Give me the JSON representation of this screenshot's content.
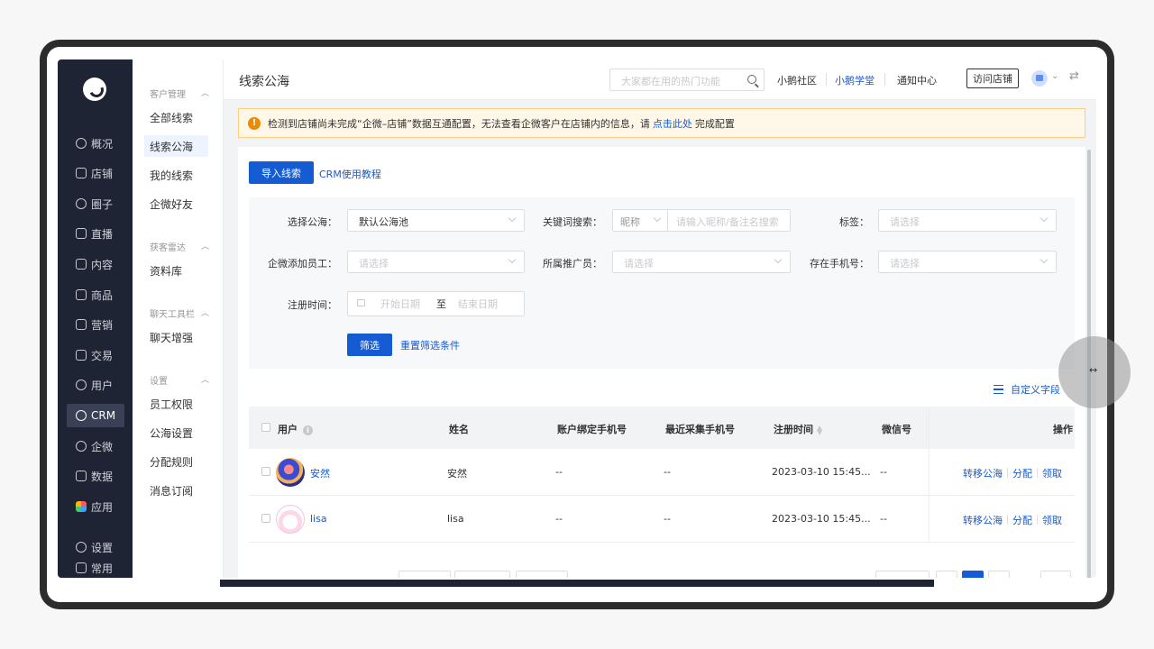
{
  "nav": {
    "items": [
      {
        "label": "概况",
        "icon": "dashboard-icon"
      },
      {
        "label": "店铺",
        "icon": "store-icon"
      },
      {
        "label": "圈子",
        "icon": "circle-icon"
      },
      {
        "label": "直播",
        "icon": "live-icon"
      },
      {
        "label": "内容",
        "icon": "content-icon"
      },
      {
        "label": "商品",
        "icon": "goods-icon"
      },
      {
        "label": "营销",
        "icon": "marketing-icon"
      },
      {
        "label": "交易",
        "icon": "trade-icon"
      },
      {
        "label": "用户",
        "icon": "user-icon"
      },
      {
        "label": "CRM",
        "icon": "crm-icon",
        "active": true
      },
      {
        "label": "企微",
        "icon": "wecom-icon"
      },
      {
        "label": "数据",
        "icon": "data-icon"
      },
      {
        "label": "应用",
        "icon": "app-icon"
      }
    ],
    "bottom": [
      {
        "label": "设置",
        "icon": "gear-icon"
      },
      {
        "label": "常用",
        "icon": "list-icon"
      }
    ]
  },
  "subnav": {
    "groups": [
      {
        "title": "客户管理",
        "items": [
          "全部线索",
          "线索公海",
          "我的线索",
          "企微好友"
        ]
      },
      {
        "title": "获客雷达",
        "items": [
          "资料库"
        ]
      },
      {
        "title": "聊天工具栏",
        "items": [
          "聊天增强"
        ]
      },
      {
        "title": "设置",
        "items": [
          "员工权限",
          "公海设置",
          "分配规则",
          "消息订阅"
        ]
      }
    ],
    "active": "线索公海"
  },
  "header": {
    "title": "线索公海",
    "search_placeholder": "大家都在用的热门功能",
    "links": [
      "小鹅社区",
      "小鹅学堂",
      "通知中心"
    ],
    "visit_store": "访问店铺"
  },
  "notice": {
    "text_before": "检测到店铺尚未完成“企微–店铺”数据互通配置，无法查看企微客户在店铺内的信息，请",
    "link": "点击此处",
    "text_after": "完成配置"
  },
  "actions": {
    "import_label": "导入线索",
    "tutorial_label": "CRM使用教程"
  },
  "filters": {
    "pool_label": "选择公海：",
    "pool_value": "默认公海池",
    "keyword_label": "关键词搜索：",
    "keyword_type": "昵称",
    "keyword_placeholder": "请输入昵称/备注名搜索",
    "tag_label": "标签：",
    "tag_placeholder": "请选择",
    "staff_label": "企微添加员工：",
    "staff_placeholder": "请选择",
    "promoter_label": "所属推广员：",
    "promoter_placeholder": "请选择",
    "phone_label": "存在手机号：",
    "phone_placeholder": "请选择",
    "reg_label": "注册时间：",
    "date_start": "开始日期",
    "date_to": "至",
    "date_end": "结束日期",
    "filter_btn": "筛选",
    "reset_btn": "重置筛选条件"
  },
  "custom_field_label": "自定义字段",
  "table": {
    "columns": [
      "用户",
      "姓名",
      "账户绑定手机号",
      "最近采集手机号",
      "注册时间",
      "微信号",
      "操作"
    ],
    "rows": [
      {
        "user": "安然",
        "name": "安然",
        "bound_phone": "--",
        "recent_phone": "--",
        "reg_time": "2023-03-10 15:45...",
        "wechat": "--",
        "ops": [
          "转移公海",
          "分配",
          "领取"
        ]
      },
      {
        "user": "lisa",
        "name": "lisa",
        "bound_phone": "--",
        "recent_phone": "--",
        "reg_time": "2023-03-10 15:45...",
        "wechat": "--",
        "ops": [
          "转移公海",
          "分配",
          "领取"
        ]
      }
    ]
  },
  "colors": {
    "primary": "#155bd4",
    "nav_bg": "#1f2434",
    "notice_bg": "#fff7e8",
    "warn": "#ed8a00"
  }
}
